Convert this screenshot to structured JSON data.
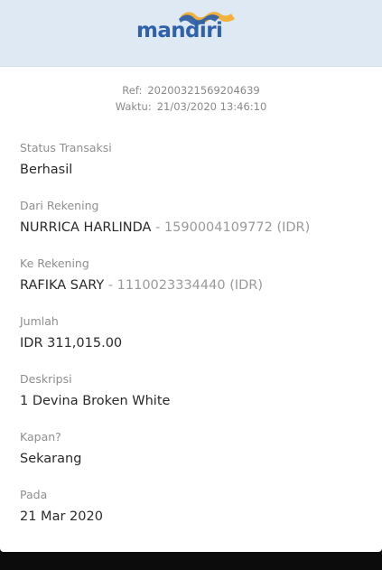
{
  "header": {
    "logo_text": "mandiri",
    "brand_color": "#2f62a8",
    "accent_color": "#f2b13a",
    "logo_icon": "mandiri-wave-logo"
  },
  "reference": {
    "ref_label": "Ref:",
    "ref_value": "20200321569204639",
    "time_label": "Waktu:",
    "time_value": "21/03/2020 13:46:10"
  },
  "fields": {
    "status": {
      "label": "Status Transaksi",
      "value": "Berhasil"
    },
    "from": {
      "label": "Dari Rekening",
      "name": "NURRICA HARLINDA",
      "separator": " - ",
      "account": "1590004109772 (IDR)"
    },
    "to": {
      "label": "Ke Rekening",
      "name": "RAFIKA SARY",
      "separator": " - ",
      "account": "1110023334440 (IDR)"
    },
    "amount": {
      "label": "Jumlah",
      "value": "IDR 311,015.00"
    },
    "description": {
      "label": "Deskripsi",
      "value": "1 Devina Broken White"
    },
    "when": {
      "label": "Kapan?",
      "value": "Sekarang"
    },
    "date": {
      "label": "Pada",
      "value": "21 Mar 2020"
    }
  }
}
